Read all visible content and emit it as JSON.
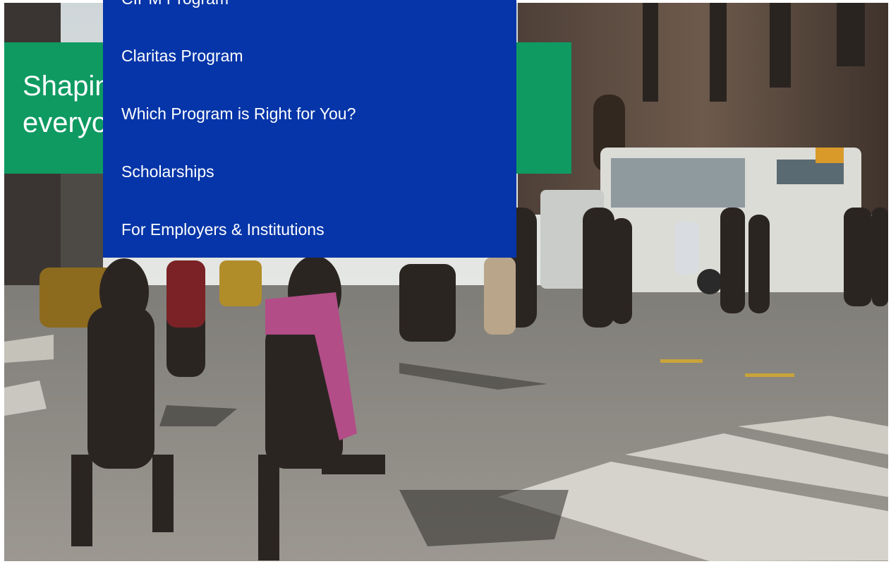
{
  "hero": {
    "headline": "Shaping a financial system that serves everyone"
  },
  "menu": {
    "items": [
      {
        "label": "CIPM Program"
      },
      {
        "label": "Claritas Program"
      },
      {
        "label": "Which Program is Right for You?"
      },
      {
        "label": "Scholarships"
      },
      {
        "label": "For Employers & Institutions"
      }
    ]
  },
  "colors": {
    "menu_background": "#0535a8",
    "banner_background": "#0f9a62",
    "text": "#ffffff"
  },
  "icons": []
}
